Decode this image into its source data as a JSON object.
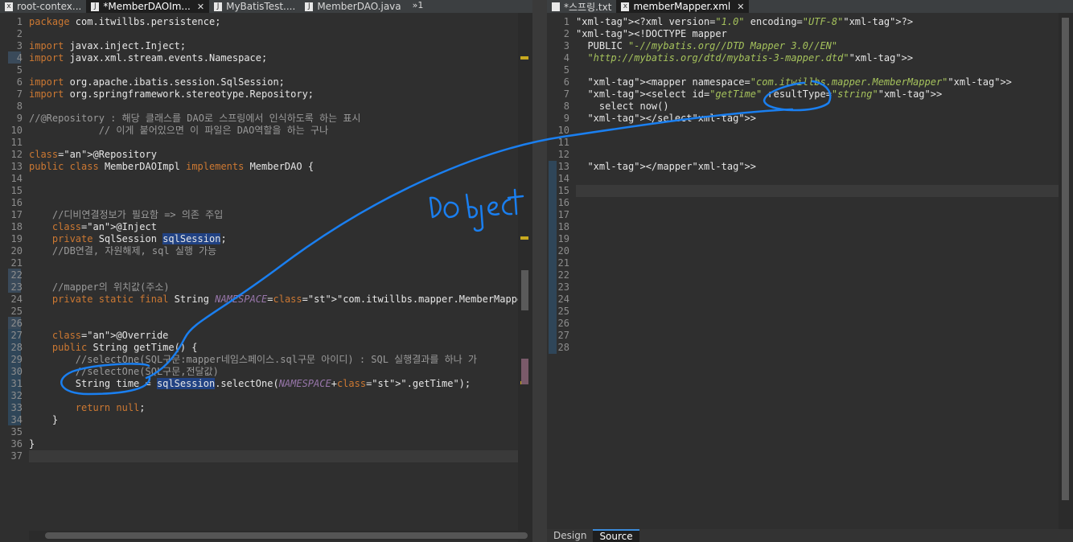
{
  "left_tabs": [
    {
      "label": "root-contex...",
      "icon": "xml-file-icon",
      "active": false
    },
    {
      "label": "*MemberDAOIm...",
      "icon": "java-file-icon",
      "active": true
    },
    {
      "label": "MyBatisTest....",
      "icon": "java-file-icon",
      "active": false
    },
    {
      "label": "MemberDAO.java",
      "icon": "java-file-icon",
      "active": false
    }
  ],
  "left_overflow": "»1",
  "right_tabs": [
    {
      "label": "*스프링.txt",
      "icon": "text-file-icon",
      "active": false
    },
    {
      "label": "memberMapper.xml",
      "icon": "xml-file-icon",
      "active": true
    }
  ],
  "java_lines": [
    {
      "n": "1",
      "t": "package com.itwillbs.persistence;"
    },
    {
      "n": "2",
      "t": ""
    },
    {
      "n": "3",
      "t": "import javax.inject.Inject;"
    },
    {
      "n": "4",
      "t": "import javax.xml.stream.events.Namespace;"
    },
    {
      "n": "5",
      "t": ""
    },
    {
      "n": "6",
      "t": "import org.apache.ibatis.session.SqlSession;"
    },
    {
      "n": "7",
      "t": "import org.springframework.stereotype.Repository;"
    },
    {
      "n": "8",
      "t": ""
    },
    {
      "n": "9",
      "t": "//@Repository : 해당 클래스를 DAO로 스프링에서 인식하도록 하는 표시"
    },
    {
      "n": "10",
      "t": "            // 이게 붙어있으면 이 파일은 DAO역할을 하는 구나"
    },
    {
      "n": "11",
      "t": ""
    },
    {
      "n": "12",
      "t": "@Repository"
    },
    {
      "n": "13",
      "t": "public class MemberDAOImpl implements MemberDAO {"
    },
    {
      "n": "14",
      "t": ""
    },
    {
      "n": "15",
      "t": ""
    },
    {
      "n": "16",
      "t": ""
    },
    {
      "n": "17",
      "t": "    //디비연결정보가 필요함 => 의존 주입"
    },
    {
      "n": "18",
      "t": "    @Inject"
    },
    {
      "n": "19",
      "t": "    private SqlSession sqlSession;"
    },
    {
      "n": "20",
      "t": "    //DB연결, 자원해제, sql 실행 가능"
    },
    {
      "n": "21",
      "t": ""
    },
    {
      "n": "22",
      "t": ""
    },
    {
      "n": "23",
      "t": "    //mapper의 위치값(주소)"
    },
    {
      "n": "24",
      "t": "    private static final String NAMESPACE=\"com.itwillbs.mapper.MemberMapper\";"
    },
    {
      "n": "25",
      "t": ""
    },
    {
      "n": "26",
      "t": ""
    },
    {
      "n": "27",
      "t": "    @Override"
    },
    {
      "n": "28",
      "t": "    public String getTime() {"
    },
    {
      "n": "29",
      "t": "        //selectOne(SQL구문:mapper네임스페이스.sql구문 아이디) : SQL 실행결과를 하나 가"
    },
    {
      "n": "30",
      "t": "        //selectOne(SQL구문,전달값)"
    },
    {
      "n": "31",
      "t": "        String time = sqlSession.selectOne(NAMESPACE+\".getTime\");"
    },
    {
      "n": "32",
      "t": ""
    },
    {
      "n": "33",
      "t": "        return null;"
    },
    {
      "n": "34",
      "t": "    }"
    },
    {
      "n": "35",
      "t": ""
    },
    {
      "n": "36",
      "t": "}"
    },
    {
      "n": "37",
      "t": ""
    }
  ],
  "xml_lines": [
    {
      "n": "1",
      "t": "<?xml version=\"1.0\" encoding=\"UTF-8\"?>"
    },
    {
      "n": "2",
      "t": "<!DOCTYPE mapper"
    },
    {
      "n": "3",
      "t": "  PUBLIC \"-//mybatis.org//DTD Mapper 3.0//EN\""
    },
    {
      "n": "4",
      "t": "  \"http://mybatis.org/dtd/mybatis-3-mapper.dtd\">"
    },
    {
      "n": "5",
      "t": ""
    },
    {
      "n": "6",
      "t": "  <mapper namespace=\"com.itwillbs.mapper.MemberMapper\">"
    },
    {
      "n": "7",
      "t": "  <select id=\"getTime\" resultType=\"string\">"
    },
    {
      "n": "8",
      "t": "    select now()"
    },
    {
      "n": "9",
      "t": "  </select>"
    },
    {
      "n": "10",
      "t": ""
    },
    {
      "n": "11",
      "t": ""
    },
    {
      "n": "12",
      "t": ""
    },
    {
      "n": "13",
      "t": "  </mapper>"
    },
    {
      "n": "14",
      "t": ""
    },
    {
      "n": "15",
      "t": ""
    },
    {
      "n": "16",
      "t": ""
    },
    {
      "n": "17",
      "t": ""
    },
    {
      "n": "18",
      "t": ""
    },
    {
      "n": "19",
      "t": ""
    },
    {
      "n": "20",
      "t": ""
    },
    {
      "n": "21",
      "t": ""
    },
    {
      "n": "22",
      "t": ""
    },
    {
      "n": "23",
      "t": ""
    },
    {
      "n": "24",
      "t": ""
    },
    {
      "n": "25",
      "t": ""
    },
    {
      "n": "26",
      "t": ""
    },
    {
      "n": "27",
      "t": ""
    },
    {
      "n": "28",
      "t": ""
    }
  ],
  "bottom_tabs": [
    {
      "label": "Design",
      "active": false
    },
    {
      "label": "Source",
      "active": true
    }
  ],
  "annotation": {
    "text": "Object",
    "color": "#1a7ff0"
  },
  "colors": {
    "keyword": "#cc7832",
    "string": "#a5c25c",
    "annotation": "#bbb529",
    "selection": "#214283"
  }
}
